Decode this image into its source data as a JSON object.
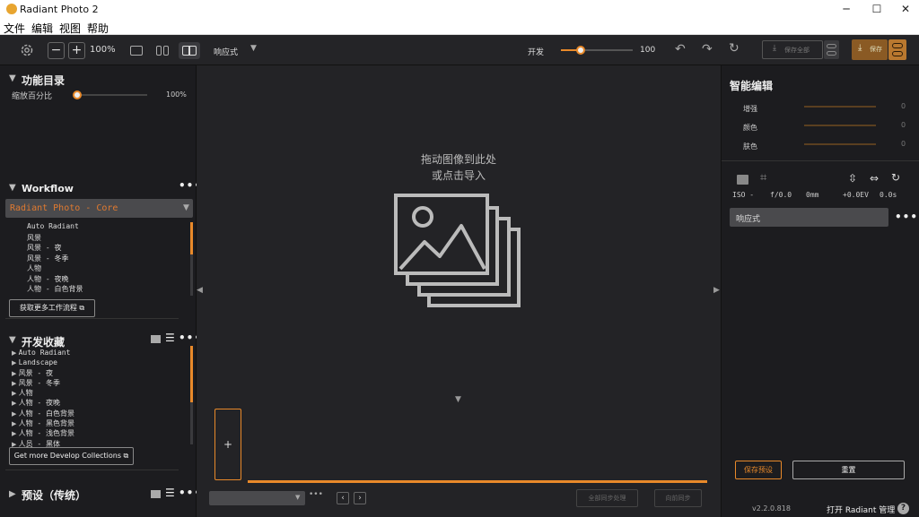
{
  "window": {
    "title": "Radiant Photo 2"
  },
  "menu": [
    "文件",
    "编辑",
    "视图",
    "帮助"
  ],
  "toolbar": {
    "zoom": "100%",
    "mode": "响应式",
    "strength_label": "开发",
    "strength_value": "100",
    "strength_fraction": 0.28,
    "save_all_label": "保存全部",
    "save_label": "保存"
  },
  "left": {
    "catalog_title": "功能目录",
    "scale_label": "缩放百分比",
    "scale_value": "100%",
    "workflow_title": "Workflow",
    "workflow_select": "Radiant Photo - Core",
    "workflow_items": [
      "Auto Radiant",
      "风景",
      "风景 - 夜",
      "风景 - 冬季",
      "人物",
      "人物 - 夜晚",
      "人物 - 白色背景"
    ],
    "more_workflows_label": "获取更多工作流程",
    "dev_title": "开发收藏",
    "dev_items": [
      "Auto Radiant",
      "Landscape",
      "风景 - 夜",
      "风景 - 冬季",
      "人物",
      "人物 - 夜晚",
      "人物 - 白色背景",
      "人物 - 黑色背景",
      "人物 - 浅色背景",
      "人员 - 黑体"
    ],
    "more_collections_label": "Get more Develop Collections",
    "presets_title": "预设（传统）"
  },
  "center": {
    "drop_line1": "拖动图像到此处",
    "drop_line2": "或点击导入",
    "add_label": "+",
    "sync_all_label": "全部同步处理",
    "sync_forward_label": "向前同步"
  },
  "right": {
    "smart_title": "智能编辑",
    "smart_rows": [
      {
        "label": "增强",
        "value": "0"
      },
      {
        "label": "颜色",
        "value": "0"
      },
      {
        "label": "肤色",
        "value": "0"
      }
    ],
    "exif": {
      "iso": "ISO -",
      "aperture": "f/0.0",
      "focal": "0mm",
      "ev": "+0.0EV",
      "shutter": "0.0s"
    },
    "preset_name": "响应式",
    "save_preset_label": "保存预设",
    "reset_label": "重置",
    "version": "v2.2.0.818",
    "open_manager_label": "打开 Radiant 管理",
    "help_label": "?"
  },
  "colors": {
    "accent": "#e8892a",
    "bg": "#1c1c1f"
  }
}
